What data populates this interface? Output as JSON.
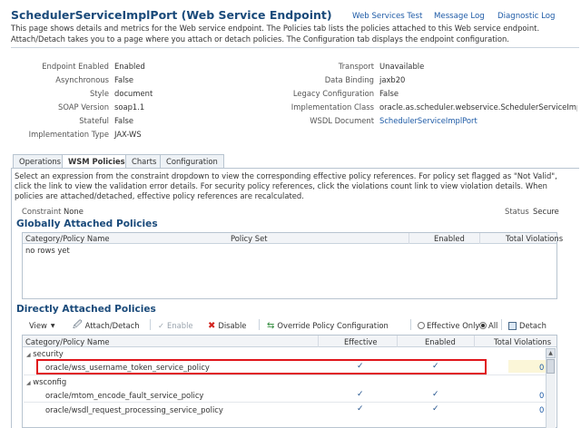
{
  "header": {
    "title": "SchedulerServiceImplPort (Web Service Endpoint)",
    "links": [
      "Web Services Test",
      "Message Log",
      "Diagnostic Log"
    ],
    "description": "This page shows details and metrics for the Web service endpoint. The Policies tab lists the policies attached to this Web service endpoint. Attach/Detach takes you to a page where you attach or detach policies. The Configuration tab displays the endpoint configuration."
  },
  "details_left": [
    {
      "label": "Endpoint Enabled",
      "value": "Enabled"
    },
    {
      "label": "Asynchronous",
      "value": "False"
    },
    {
      "label": "Style",
      "value": "document"
    },
    {
      "label": "SOAP Version",
      "value": "soap1.1"
    },
    {
      "label": "Stateful",
      "value": "False"
    },
    {
      "label": "Implementation Type",
      "value": "JAX-WS"
    }
  ],
  "details_right": [
    {
      "label": "Transport",
      "value": "Unavailable"
    },
    {
      "label": "Data Binding",
      "value": "jaxb20"
    },
    {
      "label": "Legacy Configuration",
      "value": "False"
    },
    {
      "label": "Implementation Class",
      "value": "oracle.as.scheduler.webservice.SchedulerServiceImpl"
    },
    {
      "label": "WSDL Document",
      "value": "SchedulerServiceImplPort"
    }
  ],
  "tabs": [
    "Operations",
    "WSM Policies",
    "Charts",
    "Configuration"
  ],
  "active_tab": "WSM Policies",
  "tab_description": "Select an expression from the constraint dropdown to view the corresponding effective policy references. For policy set flagged as \"Not Valid\", click the link to view the validation error details. For security policy references, click the violations count link to view violation details. When policies are attached/detached, effective policy references are recalculated.",
  "constraint": {
    "label": "Constraint",
    "value": "None"
  },
  "status": {
    "label": "Status",
    "value": "Secure"
  },
  "global": {
    "title": "Globally Attached Policies",
    "columns": [
      "Category/Policy Name",
      "Policy Set",
      "Enabled",
      "Total Violations"
    ],
    "empty_text": "no rows yet"
  },
  "direct": {
    "title": "Directly Attached Policies",
    "toolbar": {
      "view": "View",
      "attach_detach": "Attach/Detach",
      "enable": "Enable",
      "disable": "Disable",
      "override": "Override Policy Configuration",
      "effective_only": "Effective Only",
      "all": "All",
      "detach": "Detach"
    },
    "columns": [
      "Category/Policy Name",
      "Effective",
      "Enabled",
      "Total Violations"
    ],
    "groups": [
      {
        "name": "security",
        "rows": [
          {
            "name": "oracle/wss_username_token_service_policy",
            "effective": "✓",
            "enabled": "✓",
            "violations": "0"
          }
        ]
      },
      {
        "name": "wsconfig",
        "rows": [
          {
            "name": "oracle/mtom_encode_fault_service_policy",
            "effective": "✓",
            "enabled": "✓",
            "violations": "0"
          },
          {
            "name": "oracle/wsdl_request_processing_service_policy",
            "effective": "✓",
            "enabled": "✓",
            "violations": "0"
          }
        ]
      }
    ]
  },
  "colors": {
    "title": "#1a4a7a",
    "link": "#1d5aa6",
    "highlight": "#e0161b",
    "check": "#1d4f8a"
  }
}
